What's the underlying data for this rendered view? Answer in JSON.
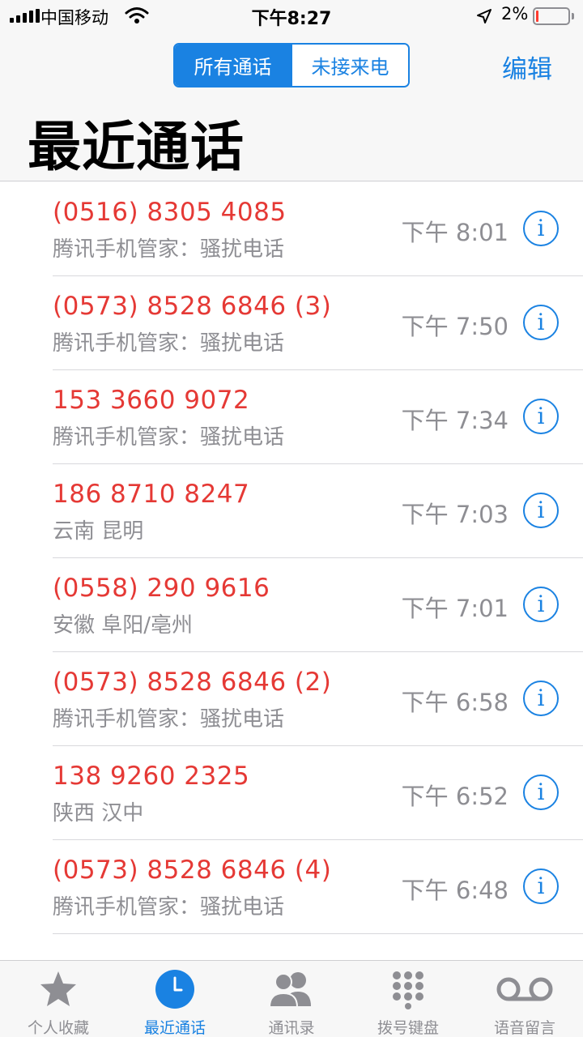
{
  "status_bar": {
    "carrier": "中国移动",
    "time": "下午8:27",
    "battery_percent": "2%",
    "battery_level": 0.02,
    "icons": [
      "signal-icon",
      "wifi-icon",
      "location-arrow-icon",
      "battery-icon"
    ]
  },
  "header": {
    "segments": [
      {
        "label": "所有通话",
        "selected": true
      },
      {
        "label": "未接来电",
        "selected": false
      }
    ],
    "edit_label": "编辑",
    "title": "最近通话"
  },
  "calls": [
    {
      "number": "(0516) 8305 4085",
      "description": "腾讯手机管家：骚扰电话",
      "time": "下午 8:01"
    },
    {
      "number": "(0573) 8528 6846 (3)",
      "description": "腾讯手机管家：骚扰电话",
      "time": "下午 7:50"
    },
    {
      "number": "153 3660 9072",
      "description": "腾讯手机管家：骚扰电话",
      "time": "下午 7:34"
    },
    {
      "number": "186 8710 8247",
      "description": "云南 昆明",
      "time": "下午 7:03"
    },
    {
      "number": "(0558) 290 9616",
      "description": "安徽 阜阳/亳州",
      "time": "下午 7:01"
    },
    {
      "number": "(0573) 8528 6846 (2)",
      "description": "腾讯手机管家：骚扰电话",
      "time": "下午 6:58"
    },
    {
      "number": "138 9260 2325",
      "description": "陕西 汉中",
      "time": "下午 6:52"
    },
    {
      "number": "(0573) 8528 6846 (4)",
      "description": "腾讯手机管家：骚扰电话",
      "time": "下午 6:48"
    }
  ],
  "tab_bar": {
    "tabs": [
      {
        "label": "个人收藏",
        "icon": "star-icon",
        "active": false
      },
      {
        "label": "最近通话",
        "icon": "clock-icon",
        "active": true
      },
      {
        "label": "通讯录",
        "icon": "contacts-icon",
        "active": false
      },
      {
        "label": "拨号键盘",
        "icon": "keypad-icon",
        "active": false
      },
      {
        "label": "语音留言",
        "icon": "voicemail-icon",
        "active": false
      }
    ]
  },
  "colors": {
    "accent": "#1a82e2",
    "missed_call": "#e53935",
    "secondary_text": "#8e8e93",
    "battery_low": "#ff3b30"
  }
}
